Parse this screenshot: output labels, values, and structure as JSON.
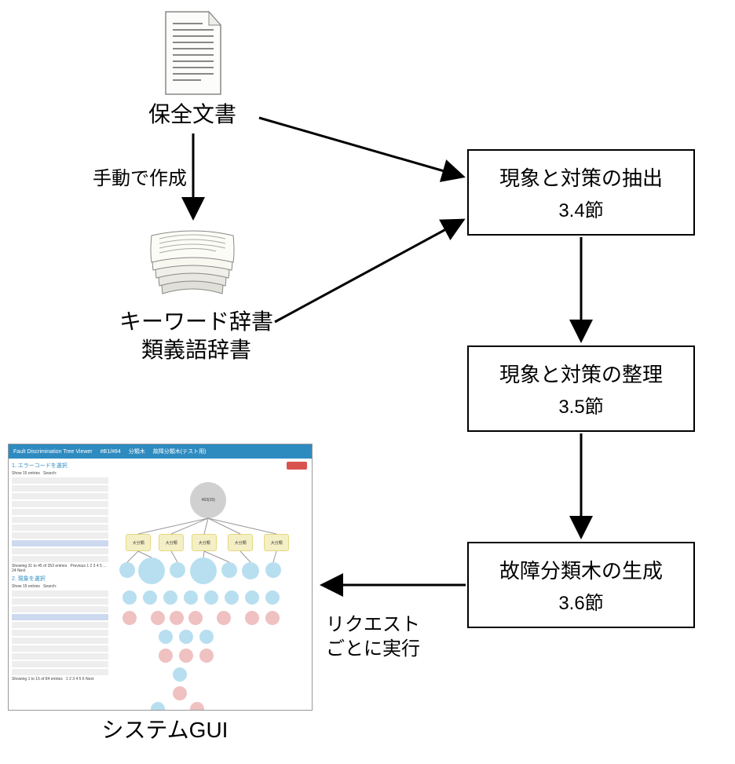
{
  "nodes": {
    "doc": {
      "title": "保全文書"
    },
    "dict": {
      "title": "キーワード辞書\n類義語辞書"
    },
    "gui": {
      "title": "システムGUI"
    }
  },
  "boxes": {
    "extract": {
      "title": "現象と対策の抽出",
      "sub": "3.4節"
    },
    "organize": {
      "title": "現象と対策の整理",
      "sub": "3.5節"
    },
    "tree": {
      "title": "故障分類木の生成",
      "sub": "3.6節"
    }
  },
  "edges": {
    "manual": "手動で作成",
    "per_request": "リクエスト\nごとに実行"
  },
  "gui_mock": {
    "app_title": "Fault Discrimination Tree Viewer",
    "side_h1": "1. エラーコードを選択",
    "side_h2": "2. 現象を選択",
    "root": "#63(15)"
  }
}
